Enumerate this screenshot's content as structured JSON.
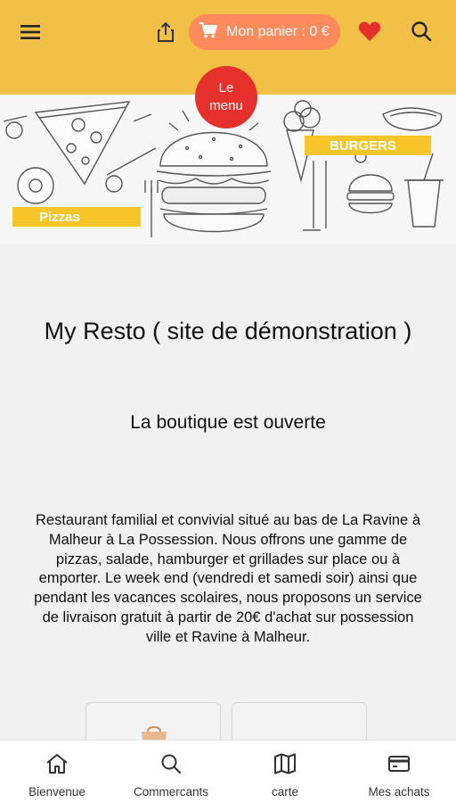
{
  "header": {
    "cart_label": "Mon panier : 0 €",
    "icons": [
      "menu-icon",
      "share-icon",
      "cart-icon",
      "heart-icon",
      "search-icon"
    ],
    "accent_color": "#f2c046",
    "cart_color": "#ff8a5b",
    "heart_color": "#e5302b"
  },
  "menu_badge": {
    "line1": "Le",
    "line2": "menu"
  },
  "banner": {
    "pizzas_label": "Pizzas",
    "burgers_label": "BURGERS"
  },
  "main": {
    "title": "My Resto ( site de démonstration )",
    "status": "La boutique est ouverte",
    "description": "Restaurant familial et convivial situé au bas de La Ravine à Malheur à La Possession. Nous offrons une gamme de pizzas, salade, hamburger et grillades sur place ou à emporter. Le week end (vendredi et samedi soir) ainsi que pendant les vacances scolaires, nous proposons un service de livraison gratuit à partir de 20€ d'achat sur possession ville et Ravine à Malheur."
  },
  "bottom_nav": {
    "items": [
      {
        "label": "Bienvenue",
        "icon": "home-icon"
      },
      {
        "label": "Commercants",
        "icon": "search-icon"
      },
      {
        "label": "carte",
        "icon": "map-icon"
      },
      {
        "label": "Mes achats",
        "icon": "card-icon"
      }
    ]
  }
}
